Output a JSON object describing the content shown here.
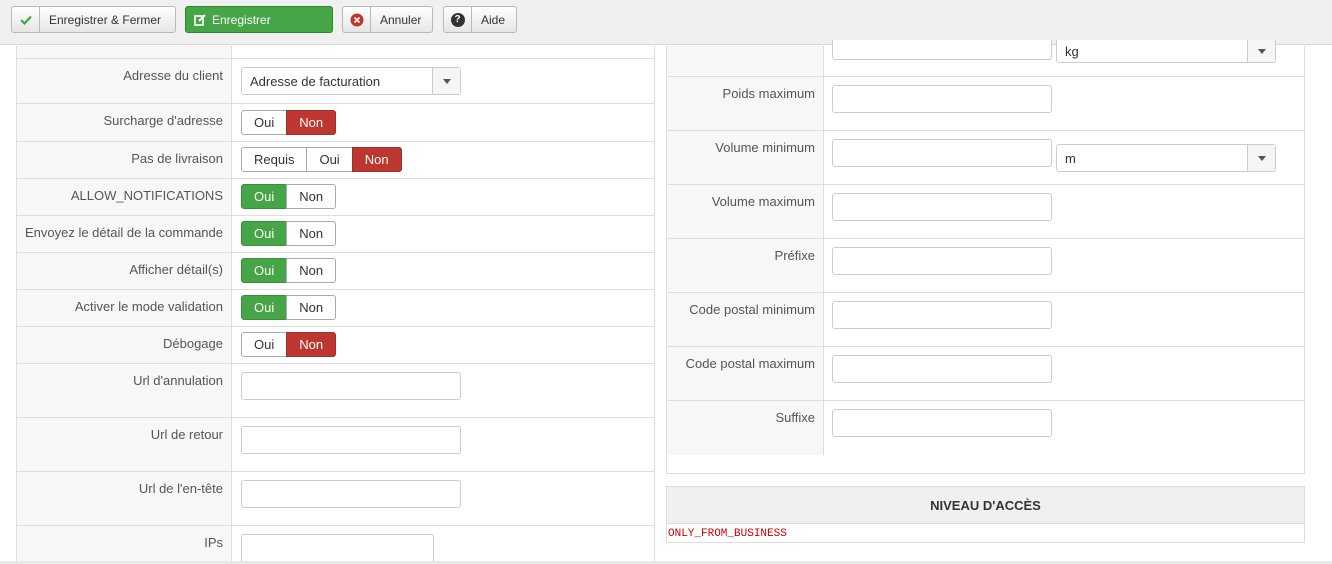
{
  "toolbar": {
    "save_close": "Enregistrer & Fermer",
    "save": "Enregistrer",
    "cancel": "Annuler",
    "help": "Aide",
    "help_glyph": "?"
  },
  "left": {
    "customer_address": {
      "label": "Adresse du client",
      "value": "Adresse de facturation"
    },
    "address_override": {
      "label": "Surcharge d'adresse",
      "opt1": "Oui",
      "opt2": "Non"
    },
    "no_shipping": {
      "label": "Pas de livraison",
      "opt1": "Requis",
      "opt2": "Oui",
      "opt3": "Non"
    },
    "allow_notifications": {
      "label": "ALLOW_NOTIFICATIONS",
      "opt1": "Oui",
      "opt2": "Non"
    },
    "send_order_detail": {
      "label": "Envoyez le détail de la commande",
      "opt1": "Oui",
      "opt2": "Non"
    },
    "show_details": {
      "label": "Afficher détail(s)",
      "opt1": "Oui",
      "opt2": "Non"
    },
    "validation_mode": {
      "label": "Activer le mode validation",
      "opt1": "Oui",
      "opt2": "Non"
    },
    "debug": {
      "label": "Débogage",
      "opt1": "Oui",
      "opt2": "Non"
    },
    "cancel_url": {
      "label": "Url d'annulation",
      "value": ""
    },
    "return_url": {
      "label": "Url de retour",
      "value": ""
    },
    "header_url": {
      "label": "Url de l'en-tête",
      "value": ""
    },
    "ips": {
      "label": "IPs",
      "value": ""
    }
  },
  "right": {
    "weight_unit": "kg",
    "max_weight": {
      "label": "Poids maximum",
      "value": ""
    },
    "min_volume": {
      "label": "Volume minimum",
      "value": "",
      "unit": "m"
    },
    "max_volume": {
      "label": "Volume maximum",
      "value": ""
    },
    "prefix": {
      "label": "Préfixe",
      "value": ""
    },
    "min_zip": {
      "label": "Code postal minimum",
      "value": ""
    },
    "max_zip": {
      "label": "Code postal maximum",
      "value": ""
    },
    "suffix": {
      "label": "Suffixe",
      "value": ""
    }
  },
  "access": {
    "title": "NIVEAU D'ACCÈS",
    "note": "ONLY_FROM_BUSINESS"
  },
  "colors": {
    "green": "#46a546",
    "red": "#bd362f",
    "code_red": "#cc0000"
  }
}
